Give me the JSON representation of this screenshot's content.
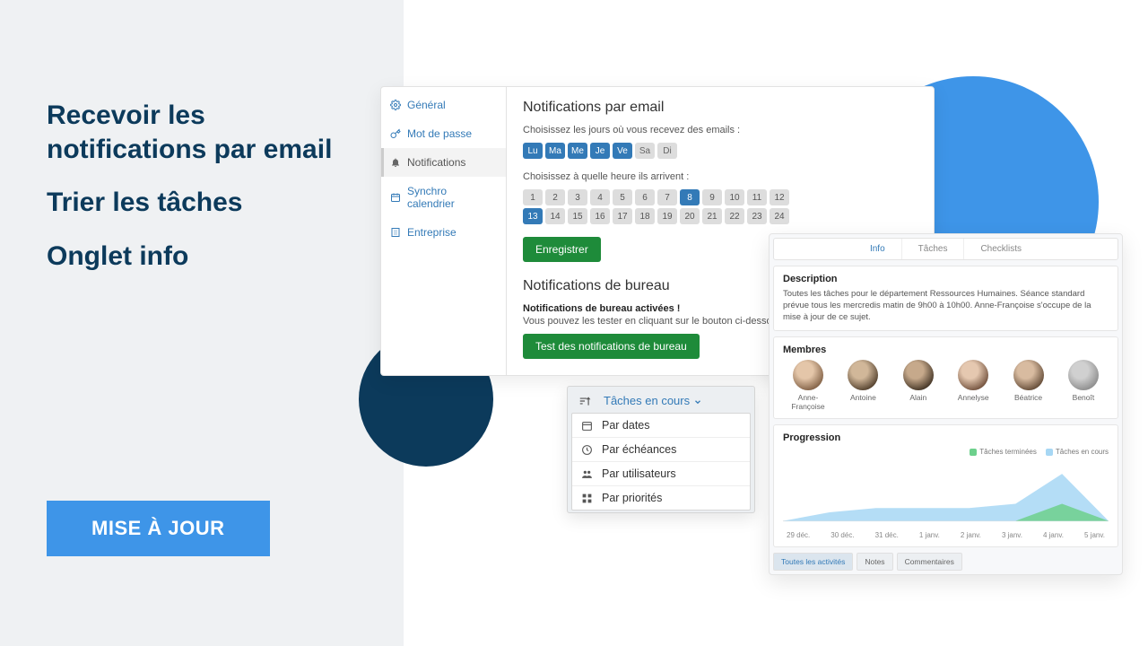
{
  "headlines": {
    "h1": "Recevoir les notifications par email",
    "h2": "Trier les tâches",
    "h3": "Onglet info"
  },
  "cta_label": "MISE À JOUR",
  "nav": {
    "general": "Général",
    "password": "Mot de passe",
    "notifications": "Notifications",
    "calendar": "Synchro calendrier",
    "company": "Entreprise"
  },
  "email_notif": {
    "title": "Notifications par email",
    "days_label": "Choisissez les jours où vous recevez des emails :",
    "days": [
      "Lu",
      "Ma",
      "Me",
      "Je",
      "Ve",
      "Sa",
      "Di"
    ],
    "days_active": [
      true,
      true,
      true,
      true,
      true,
      false,
      false
    ],
    "hours_label": "Choisissez à quelle heure ils arrivent :",
    "hours": [
      "1",
      "2",
      "3",
      "4",
      "5",
      "6",
      "7",
      "8",
      "9",
      "10",
      "11",
      "12",
      "13",
      "14",
      "15",
      "16",
      "17",
      "18",
      "19",
      "20",
      "21",
      "22",
      "23",
      "24"
    ],
    "hours_active_indices": [
      7,
      12
    ],
    "save": "Enregistrer"
  },
  "desktop_notif": {
    "title": "Notifications de bureau",
    "line1": "Notifications de bureau activées !",
    "line2": "Vous pouvez les tester en cliquant sur le bouton ci-dessous.",
    "test": "Test des notifications de bureau"
  },
  "sort": {
    "header": "Tâches en cours",
    "items": [
      "Par dates",
      "Par échéances",
      "Par utilisateurs",
      "Par priorités"
    ]
  },
  "info": {
    "tabs": [
      "Info",
      "Tâches",
      "Checklists"
    ],
    "active_tab": 0,
    "desc_title": "Description",
    "desc_body": "Toutes les tâches pour le département Ressources Humaines. Séance standard prévue tous les mercredis matin de 9h00 à 10h00. Anne-Françoise s'occupe de la mise à jour de ce sujet.",
    "members_title": "Membres",
    "members": [
      "Anne-Françoise",
      "Antoine",
      "Alain",
      "Annelyse",
      "Béatrice",
      "Benoît"
    ],
    "prog_title": "Progression",
    "legend_done": "Tâches terminées",
    "legend_prog": "Tâches en cours",
    "xaxis": [
      "29 déc.",
      "30 déc.",
      "31 déc.",
      "1 janv.",
      "2 janv.",
      "3 janv.",
      "4 janv.",
      "5 janv."
    ],
    "footer": [
      "Toutes les activités",
      "Notes",
      "Commentaires"
    ],
    "footer_active": 0
  },
  "chart_data": {
    "type": "area",
    "x": [
      "29 déc.",
      "30 déc.",
      "31 déc.",
      "1 janv.",
      "2 janv.",
      "3 janv.",
      "4 janv.",
      "5 janv."
    ],
    "series": [
      {
        "name": "Tâches en cours",
        "values": [
          0,
          2,
          3,
          3,
          3,
          4,
          11,
          0
        ]
      },
      {
        "name": "Tâches terminées",
        "values": [
          0,
          0,
          0,
          0,
          0,
          0,
          4,
          0
        ]
      }
    ],
    "ylim": [
      0,
      12
    ]
  }
}
